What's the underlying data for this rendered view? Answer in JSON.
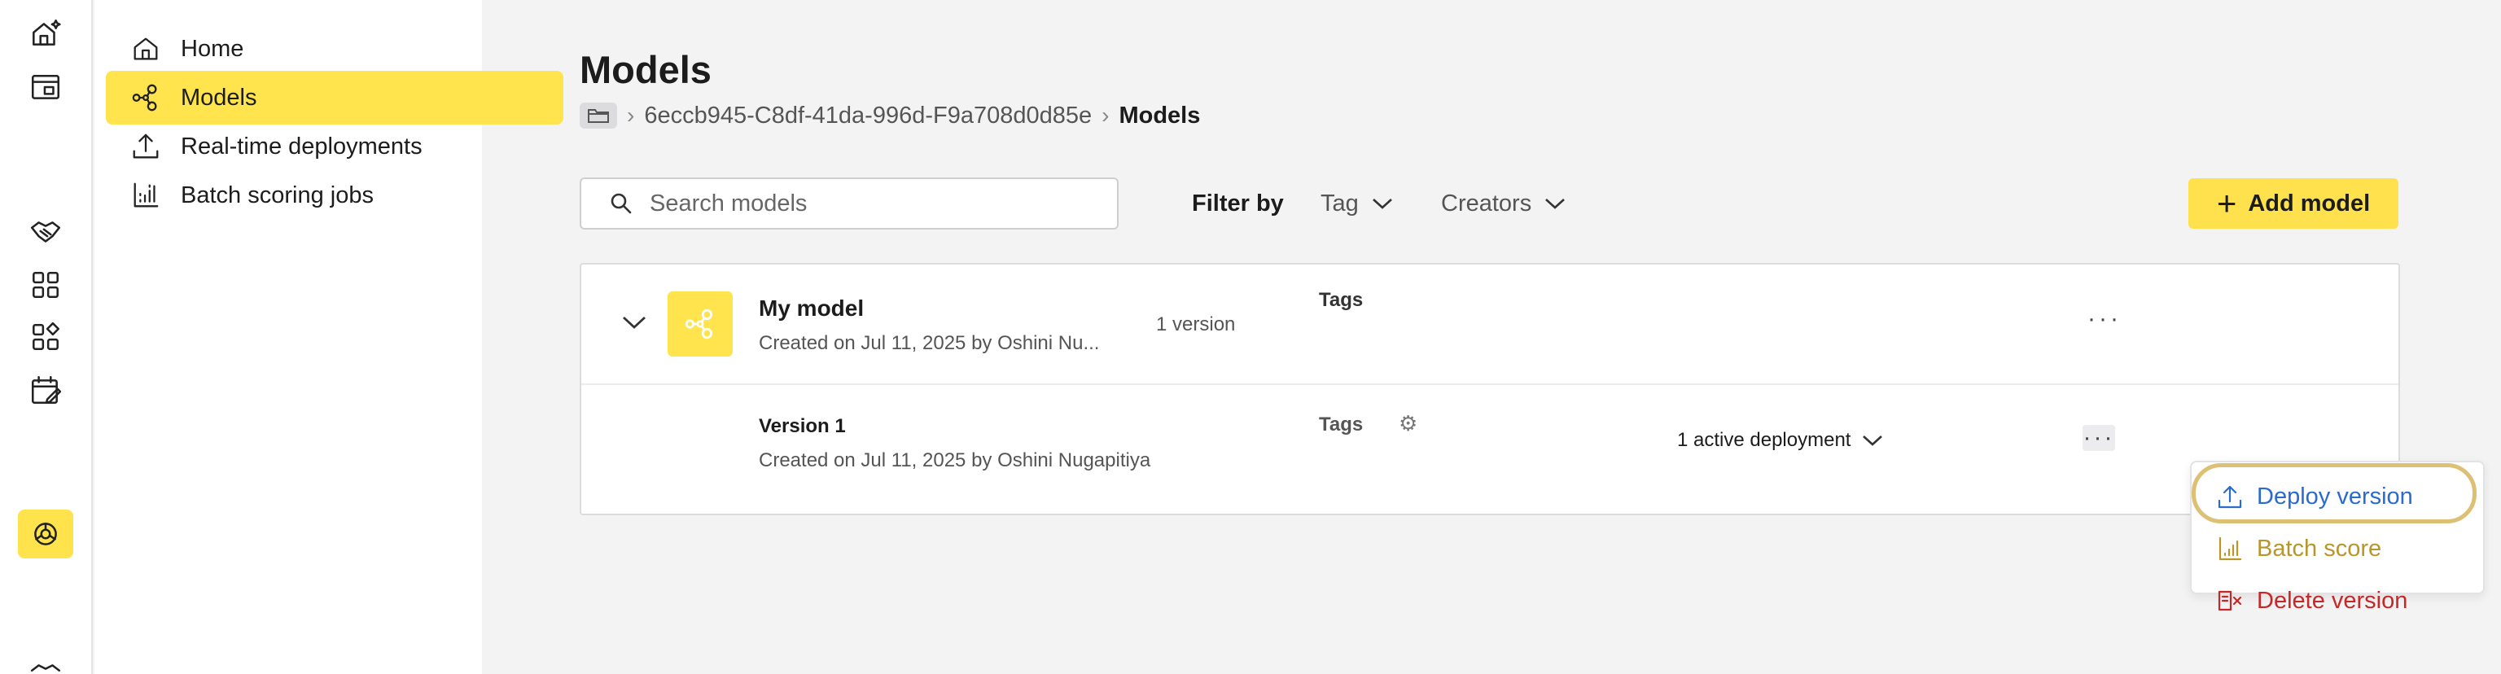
{
  "rail": {
    "icons": [
      "home-sparkle-icon",
      "store-icon",
      "handshake-icon",
      "grid-icon",
      "apps-icon",
      "calendar-edit-icon",
      "model-hub-icon",
      "partial-icon"
    ]
  },
  "sidebar": {
    "items": [
      {
        "label": "Home",
        "icon": "home-icon"
      },
      {
        "label": "Models",
        "icon": "models-icon",
        "active": true
      },
      {
        "label": "Real-time deployments",
        "icon": "upload-icon"
      },
      {
        "label": "Batch scoring jobs",
        "icon": "batch-icon"
      }
    ]
  },
  "page": {
    "title": "Models",
    "breadcrumb": {
      "project": "6eccb945-C8df-41da-996d-F9a708d0d85e",
      "current": "Models"
    }
  },
  "toolbar": {
    "search_placeholder": "Search models",
    "filter_label": "Filter by",
    "tag_filter": "Tag",
    "creators_filter": "Creators",
    "add_button": "Add model"
  },
  "model": {
    "name": "My model",
    "created": "Created on Jul 11, 2025 by Oshini Nu...",
    "versions": "1 version",
    "tags_label": "Tags",
    "version_row": {
      "name": "Version 1",
      "created": "Created on Jul 11, 2025 by Oshini Nugapitiya",
      "tags_label": "Tags",
      "deployments": "1 active deployment"
    }
  },
  "context_menu": {
    "items": [
      {
        "label": "Deploy version",
        "color": "#2a6bcc",
        "icon": "upload-icon"
      },
      {
        "label": "Batch score",
        "color": "#b8962a",
        "icon": "batch-icon"
      },
      {
        "label": "Delete version",
        "color": "#c62828",
        "icon": "delete-icon"
      }
    ]
  }
}
